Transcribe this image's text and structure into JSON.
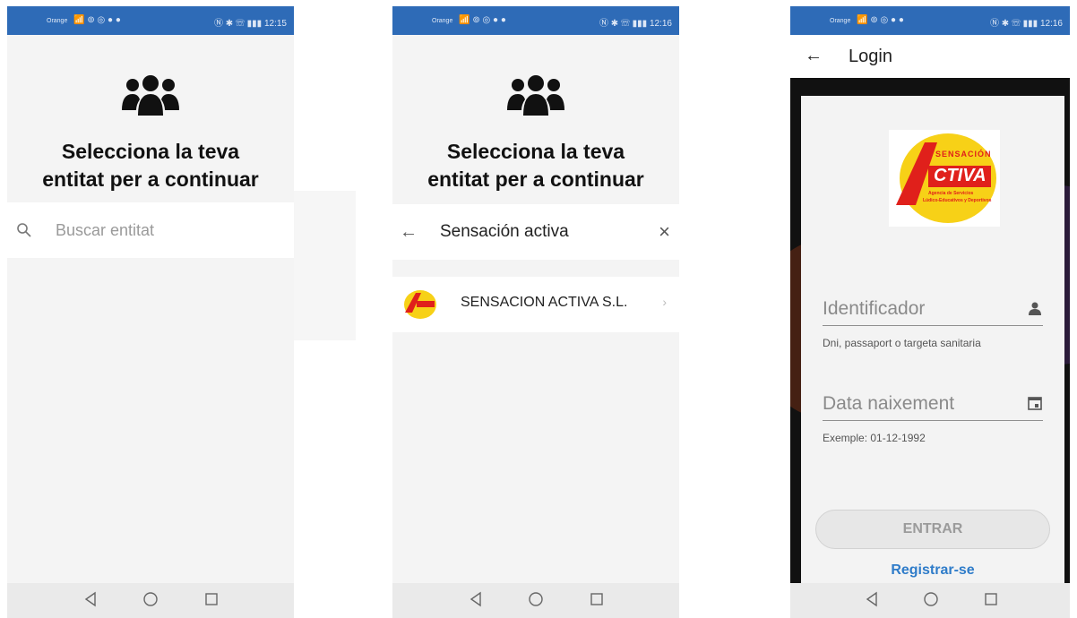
{
  "screens": [
    {
      "status": {
        "carrier": "Orange",
        "time": "12:15",
        "left_icons": "📶 ⊚ ◎ ● ●",
        "right_icons": "Ⓝ ✱ ☏ ▮▮▮"
      },
      "headline": [
        "Selecciona la teva",
        "entitat per a continuar"
      ],
      "search": {
        "placeholder": "Buscar entitat"
      }
    },
    {
      "status": {
        "carrier": "Orange",
        "time": "12:16",
        "left_icons": "📶 ⊚ ◎ ● ●",
        "right_icons": "Ⓝ ✱ ☏ ▮▮▮"
      },
      "headline": [
        "Selecciona la teva",
        "entitat per a continuar"
      ],
      "search": {
        "query": "Sensación activa"
      },
      "results": [
        {
          "name": "SENSACION ACTIVA S.L."
        }
      ]
    },
    {
      "status": {
        "carrier": "Orange",
        "time": "12:16",
        "left_icons": "📶 ⊚ ◎ ● ●",
        "right_icons": "Ⓝ ✱ ☏ ▮▮▮"
      },
      "appbar": {
        "title": "Login"
      },
      "brand": {
        "small": "SENSACIÓN",
        "big": "CTIVA",
        "tag1": "Agencia de Servicios",
        "tag2": "Lúdico-Educativos y Deportivos"
      },
      "fields": [
        {
          "label": "Identificador",
          "hint": "Dni, passaport o targeta sanitaria",
          "icon": "person-icon"
        },
        {
          "label": "Data naixement",
          "hint": "Exemple: 01-12-1992",
          "icon": "calendar-icon"
        }
      ],
      "primary_button": "ENTRAR",
      "secondary_link": "Registrar-se"
    }
  ],
  "colors": {
    "status_bar": "#2e6bb7",
    "link": "#2f7cc9",
    "logo_yellow": "#f7d117",
    "logo_red": "#e0201b"
  }
}
